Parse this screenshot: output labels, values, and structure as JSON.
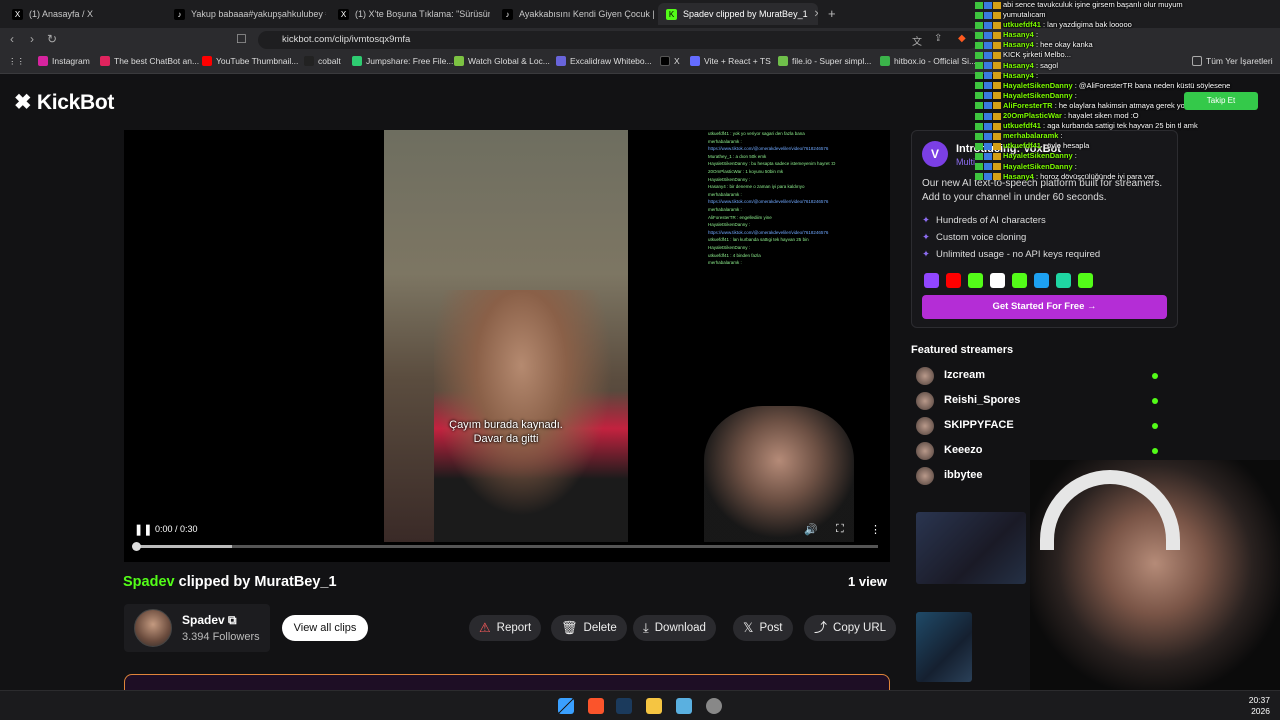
{
  "browser": {
    "tabs": [
      {
        "label": "(1) Anasayfa / X",
        "icon": "x-icon"
      },
      {
        "label": "Yakup babaaa#yakupşahkulubey #yu",
        "icon": "tiktok-icon"
      },
      {
        "label": "(1) X'te Boşuna Tıklama: \"Sürüsünü d",
        "icon": "x-icon"
      },
      {
        "label": "Ayakkabısını Kendi Giyen Çocuk | Tik",
        "icon": "tiktok-icon"
      },
      {
        "label": "Spadev clipped by MuratBey_1",
        "icon": "kick-icon",
        "active": true
      }
    ],
    "url": "kickbot.com/clip/ivmtosqx9mfa",
    "bookmarks": [
      "Instagram",
      "The best ChatBot an...",
      "YouTube Thumbnail...",
      "cobalt",
      "Jumpshare: Free File...",
      "Watch Global & Loc...",
      "Excalidraw Whitebo...",
      "X",
      "Vite + React + TS",
      "file.io - Super simpl...",
      "hitbox.io - Official Si..."
    ],
    "bookmarks_other": "Tüm Yer İşaretleri"
  },
  "site": {
    "logo": "KickBot"
  },
  "video": {
    "caption_line1": "Çayım burada kaynadı.",
    "caption_line2": "Davar da gitti",
    "time": "0:00 / 0:30",
    "progress": 0.0,
    "buffered": 0.13,
    "overlay_chat": [
      "utkuefdf41 : yok yo veriyor sagari den fazla bana",
      "merhabalaramk :",
      "https://www.tiktok.com/@omerakdeveliler/video/7618246576",
      "Murathey_1 : a dıon 50k emk",
      "HayaletSikenDanny : bu hesapta sadece istemeyenim hayret :D",
      "20OmPlasticWar : 1 koyunu 50bin mk",
      "HayaletSikenDanny :",
      "Hasany4 : bir deneme o zaman iyi para kaldırıyo",
      "merhabalaramk :",
      "https://www.tiktok.com/@omerakdeveliler/video/7618246576",
      "merhabalaramk :",
      "AliForesterTR : engellediim yine",
      "HayaletSikenDanny :",
      "https://www.tiktok.com/@omerakdeveliler/video/7618246576",
      "utkuefdf41 : lan kurbanda sattıgi tek hayvan 25 bin",
      "HayaletSikenDanny :",
      "utkuefdf41 : 4 binden fazla",
      "merhabalaramk :"
    ]
  },
  "clip": {
    "streamer": "Spadev",
    "clipped_by_text": "clipped by MuratBey_1",
    "views": "1 view",
    "channel_name": "Spadev",
    "followers": "3.394 Followers",
    "view_all_label": "View all clips"
  },
  "actions": {
    "report": "Report",
    "delete": "Delete",
    "download": "Download",
    "post": "Post",
    "copy_url": "Copy URL"
  },
  "promo": {
    "title": "Introducing: VoxBot",
    "subtitle": "Multi...",
    "text": "Our new AI text-to-speech platform built for streamers. Add to your channel in under 60 seconds.",
    "items": [
      "Hundreds of AI characters",
      "Custom voice cloning",
      "Unlimited usage - no API keys required"
    ],
    "button": "Get Started For Free →",
    "social_colors": [
      "#9146ff",
      "#ff0000",
      "#53fc18",
      "#ffffff",
      "#53fc18",
      "#1da1f2",
      "#1fd6a3",
      "#53fc18"
    ]
  },
  "featured": {
    "title": "Featured streamers",
    "streamers": [
      "Izcream",
      "Reishi_Spores",
      "SKIPPYFACE",
      "Keeezo",
      "ibbytee"
    ]
  },
  "overlay_chat": {
    "follow_button": "Takip Et",
    "lines": [
      {
        "user": "",
        "msg": "abi sence tavukculuk işine girsem başarılı olur muyum"
      },
      {
        "user": "",
        "msg": "yumutalıcam"
      },
      {
        "user": "utkuefdf41",
        "msg": ": lan yazdigima bak looooo"
      },
      {
        "user": "Hasany4",
        "msg": ":"
      },
      {
        "user": "Hasany4",
        "msg": ": hee okay kanka"
      },
      {
        "user": "",
        "msg": "KICK şirketi Melbo..."
      },
      {
        "user": "Hasany4",
        "msg": ": sagol"
      },
      {
        "user": "Hasany4",
        "msg": ":"
      },
      {
        "user": "HayaletSikenDanny",
        "msg": ": @AliForesterTR bana neden küstü söylesene"
      },
      {
        "user": "HayaletSikenDanny",
        "msg": ":"
      },
      {
        "user": "AliForesterTR",
        "msg": ": he olaylara hakimsin atmaya gerek yok"
      },
      {
        "user": "20OmPlasticWar",
        "msg": ": hayalet siken mod :O"
      },
      {
        "user": "utkuefdf41",
        "msg": ": aga kurbanda sattigi tek hayvan 25 bin tl amk"
      },
      {
        "user": "merhabalaramk",
        "msg": ":"
      },
      {
        "user": "utkuefdf41",
        "msg": ": öyle hesapla"
      },
      {
        "user": "HayaletSikenDanny",
        "msg": ":"
      },
      {
        "user": "HayaletSikenDanny",
        "msg": ":"
      },
      {
        "user": "Hasany4",
        "msg": ": horoz dövüşçülüğünde iyi para var"
      }
    ]
  },
  "taskbar": {
    "time": "20:37",
    "date": "2026"
  }
}
